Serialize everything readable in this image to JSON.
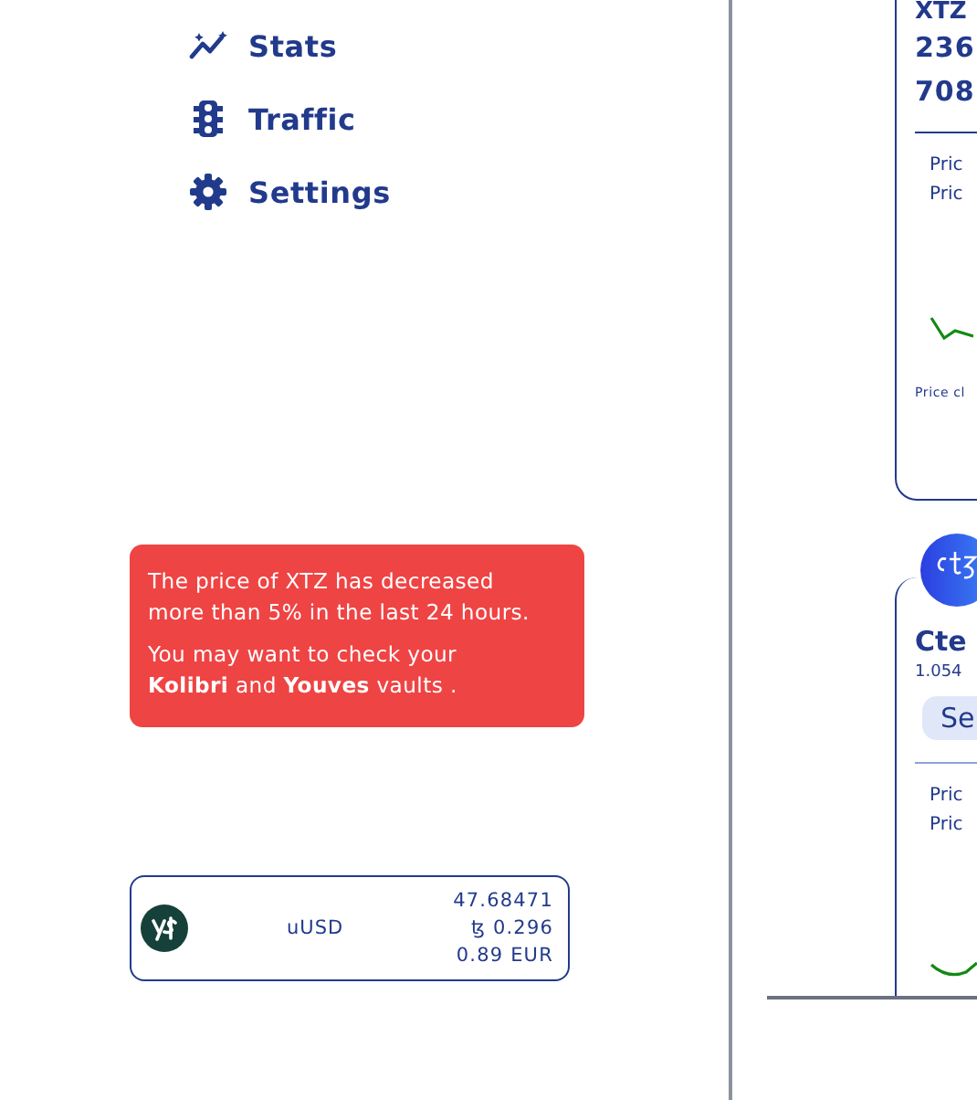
{
  "nav": [
    {
      "label": "Stats"
    },
    {
      "label": "Traffic"
    },
    {
      "label": "Settings"
    }
  ],
  "alert": {
    "paragraphs": [
      "The price of XTZ has decreased more than 5% in the last 24 hours.",
      "You may want to check your **Kolibri** and **Youves** vaults ."
    ]
  },
  "token_card": {
    "name": "uUSD",
    "values": [
      "47.68471",
      "ꜩ 0.296",
      "0.89 EUR"
    ]
  },
  "asset_cards": [
    {
      "title": "XTZ",
      "amounts": [
        "236",
        "708"
      ],
      "rows": [
        "Pric",
        "Pric"
      ],
      "footnote": "Price cl"
    },
    {
      "title": "Cte",
      "subtitle": "1.054",
      "button": "Se",
      "rows": [
        "Pric",
        "Pric"
      ]
    }
  ]
}
